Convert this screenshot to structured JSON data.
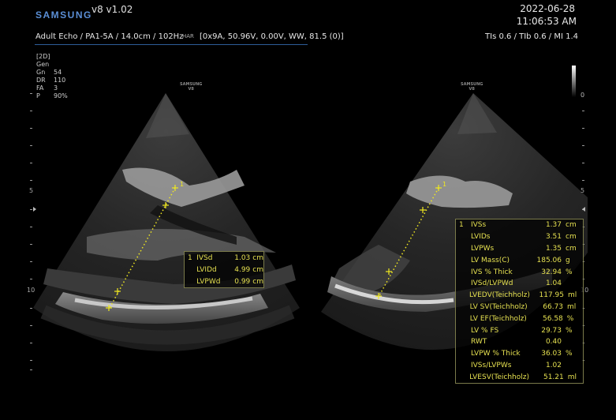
{
  "header": {
    "brand": "SAMSUNG",
    "version": "v8 v1.02",
    "date": "2022-06-28",
    "time": "11:06:53 AM",
    "probe_line": "Adult Echo / PA1-5A / 14.0cm / 102Hz",
    "probe_icon": "HAR",
    "params": "[0x9A, 50.96V, 0.00V, WW, 81.5 (0)]",
    "tis_line": "TIs  0.6 / TIb  0.6 / MI    1.4"
  },
  "mode": {
    "title": "[2D]",
    "gen": "Gen",
    "rows": [
      {
        "k": "Gn",
        "v": "54"
      },
      {
        "k": "DR",
        "v": "110"
      },
      {
        "k": "FA",
        "v": "3"
      },
      {
        "k": "P",
        "v": "90%"
      }
    ]
  },
  "watermark": {
    "line1": "SAMSUNG",
    "line2": "V8"
  },
  "depth_scale": {
    "mark5": "5",
    "mark10": "10"
  },
  "gray_bar": {
    "top_label": "0"
  },
  "left_measurements": [
    {
      "index": "1",
      "name": "IVSd",
      "value": "1.03",
      "unit": "cm"
    },
    {
      "index": "",
      "name": "LVIDd",
      "value": "4.99",
      "unit": "cm"
    },
    {
      "index": "",
      "name": "LVPWd",
      "value": "0.99",
      "unit": "cm"
    }
  ],
  "left_caliper_label": "1",
  "right_caliper_label": "1",
  "right_measurements": [
    {
      "index": "1",
      "name": "IVSs",
      "value": "1.37",
      "unit": "cm"
    },
    {
      "index": "",
      "name": "LVIDs",
      "value": "3.51",
      "unit": "cm"
    },
    {
      "index": "",
      "name": "LVPWs",
      "value": "1.35",
      "unit": "cm"
    },
    {
      "index": "",
      "name": "LV Mass(C)",
      "value": "185.06",
      "unit": "g"
    },
    {
      "index": "",
      "name": "IVS % Thick",
      "value": "32.94",
      "unit": "%"
    },
    {
      "index": "",
      "name": "IVSd/LVPWd",
      "value": "1.04",
      "unit": ""
    },
    {
      "index": "",
      "name": "LVEDV(Teichholz)",
      "value": "117.95",
      "unit": "ml"
    },
    {
      "index": "",
      "name": "LV SV(Teichholz)",
      "value": "66.73",
      "unit": "ml"
    },
    {
      "index": "",
      "name": "LV EF(Teichholz)",
      "value": "56.58",
      "unit": "%"
    },
    {
      "index": "",
      "name": "LV % FS",
      "value": "29.73",
      "unit": "%"
    },
    {
      "index": "",
      "name": "RWT",
      "value": "0.40",
      "unit": ""
    },
    {
      "index": "",
      "name": "LVPW % Thick",
      "value": "36.03",
      "unit": "%"
    },
    {
      "index": "",
      "name": "IVSs/LVPWs",
      "value": "1.02",
      "unit": ""
    },
    {
      "index": "",
      "name": "LVESV(Teichholz)",
      "value": "51.21",
      "unit": "ml"
    }
  ],
  "colors": {
    "measure_text": "#e5e050",
    "brand": "#5b8fd6",
    "caliper": "#f0e820"
  }
}
